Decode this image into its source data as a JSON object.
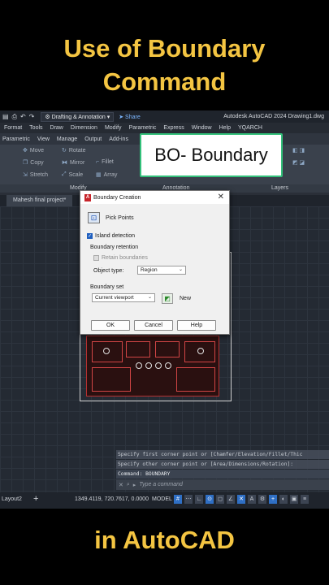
{
  "headline": {
    "line1": "Use of Boundary",
    "line2": "Command",
    "footer": "in AutoCAD"
  },
  "titlebar": {
    "workspace": "Drafting & Annotation",
    "share": "Share",
    "title": "Autodesk AutoCAD 2024   Drawing1.dwg"
  },
  "menubar": [
    "Format",
    "Tools",
    "Draw",
    "Dimension",
    "Modify",
    "Parametric",
    "Express",
    "Window",
    "Help",
    "YQARCH"
  ],
  "ribbon_tabs": [
    "Parametric",
    "View",
    "Manage",
    "Output",
    "Add-ins"
  ],
  "ribbon_tools": [
    "Move",
    "Rotate",
    "Copy",
    "Mirror",
    "Fillet",
    "Stretch",
    "Scale",
    "Array"
  ],
  "ribbon_footer": {
    "modify": "Modify",
    "annotation": "Annotation",
    "layers": "Layers"
  },
  "bubble": "BO- Boundary",
  "file_tab": "Mahesh final project*",
  "dialog": {
    "title": "Boundary Creation",
    "pick_points": "Pick Points",
    "island_detection": "Island detection",
    "boundary_retention": "Boundary retention",
    "retain_boundaries": "Retain boundaries",
    "object_type_label": "Object type:",
    "object_type_value": "Region",
    "boundary_set": "Boundary set",
    "boundary_set_value": "Current viewport",
    "new_label": "New",
    "ok": "OK",
    "cancel": "Cancel",
    "help": "Help"
  },
  "command_history": [
    "Specify first corner point or [Chamfer/Elevation/Fillet/Thic",
    "Specify other corner point or [Area/Dimensions/Rotation]:",
    "Command: BOUNDARY"
  ],
  "command_placeholder": "Type a command",
  "statusbar": {
    "layout": "Layout2",
    "coords": "1349.4119, 720.7617, 0.0000",
    "model": "MODEL"
  },
  "colors": {
    "headline": "#f4c542",
    "bubble_border": "#33c07a",
    "accent": "#2f6fc4"
  }
}
